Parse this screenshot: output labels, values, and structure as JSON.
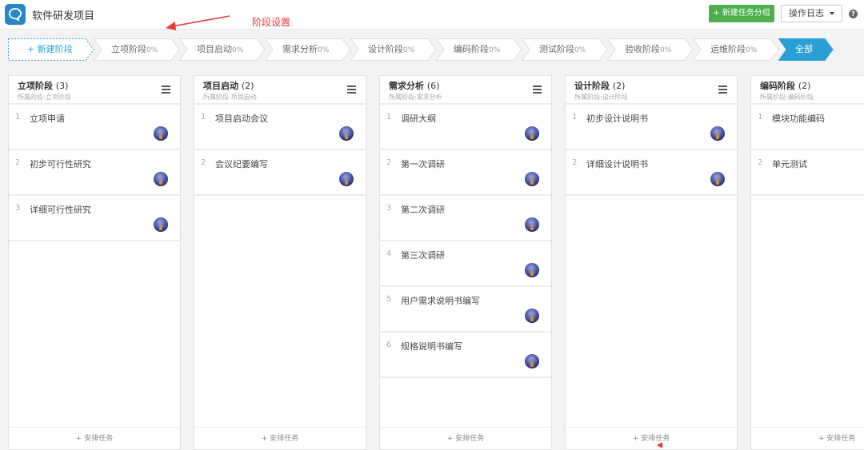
{
  "app": {
    "title": "软件研发项目",
    "logo_icon": "chat-bubble-icon"
  },
  "annotation": {
    "label": "阶段设置",
    "color": "#e23b3b"
  },
  "header": {
    "new_group_label": "+ 新建任务分组",
    "oplog_label": "操作日志",
    "help_icon": "?"
  },
  "stages": {
    "new_label": "+ 新建阶段",
    "items": [
      {
        "name": "立项阶段",
        "pct": "0%"
      },
      {
        "name": "项目启动",
        "pct": "0%"
      },
      {
        "name": "需求分析",
        "pct": "0%"
      },
      {
        "name": "设计阶段",
        "pct": "0%"
      },
      {
        "name": "编码阶段",
        "pct": "0%"
      },
      {
        "name": "测试阶段",
        "pct": "0%"
      },
      {
        "name": "验收阶段",
        "pct": "0%"
      },
      {
        "name": "运维阶段",
        "pct": "0%"
      }
    ],
    "all_label": "全部",
    "accent": "#2a9fd6"
  },
  "columns": [
    {
      "title": "立项阶段",
      "count": "(3)",
      "sub": "所属阶段:立项阶段",
      "cards": [
        {
          "num": "1",
          "title": "立项申请"
        },
        {
          "num": "2",
          "title": "初步可行性研究"
        },
        {
          "num": "3",
          "title": "详细可行性研究"
        }
      ],
      "footer": "+ 安排任务"
    },
    {
      "title": "项目启动",
      "count": "(2)",
      "sub": "所属阶段:项目启动",
      "cards": [
        {
          "num": "1",
          "title": "项目启动会议"
        },
        {
          "num": "2",
          "title": "会议纪要编写"
        }
      ],
      "footer": "+ 安排任务"
    },
    {
      "title": "需求分析",
      "count": "(6)",
      "sub": "所属阶段:需求分析",
      "cards": [
        {
          "num": "1",
          "title": "调研大纲"
        },
        {
          "num": "2",
          "title": "第一次调研"
        },
        {
          "num": "3",
          "title": "第二次调研"
        },
        {
          "num": "4",
          "title": "第三次调研"
        },
        {
          "num": "5",
          "title": "用户需求说明书编写"
        },
        {
          "num": "6",
          "title": "规格说明书编写"
        }
      ],
      "footer": "+ 安排任务"
    },
    {
      "title": "设计阶段",
      "count": "(2)",
      "sub": "所属阶段:设计阶段",
      "cards": [
        {
          "num": "1",
          "title": "初步设计说明书"
        },
        {
          "num": "2",
          "title": "详细设计说明书"
        }
      ],
      "footer": "+ 安排任务"
    },
    {
      "title": "编码阶段",
      "count": "(2)",
      "sub": "所属阶段:编码阶段",
      "cards": [
        {
          "num": "1",
          "title": "模块功能编码"
        },
        {
          "num": "2",
          "title": "单元测试"
        }
      ],
      "footer": "+ 安排任务"
    }
  ]
}
